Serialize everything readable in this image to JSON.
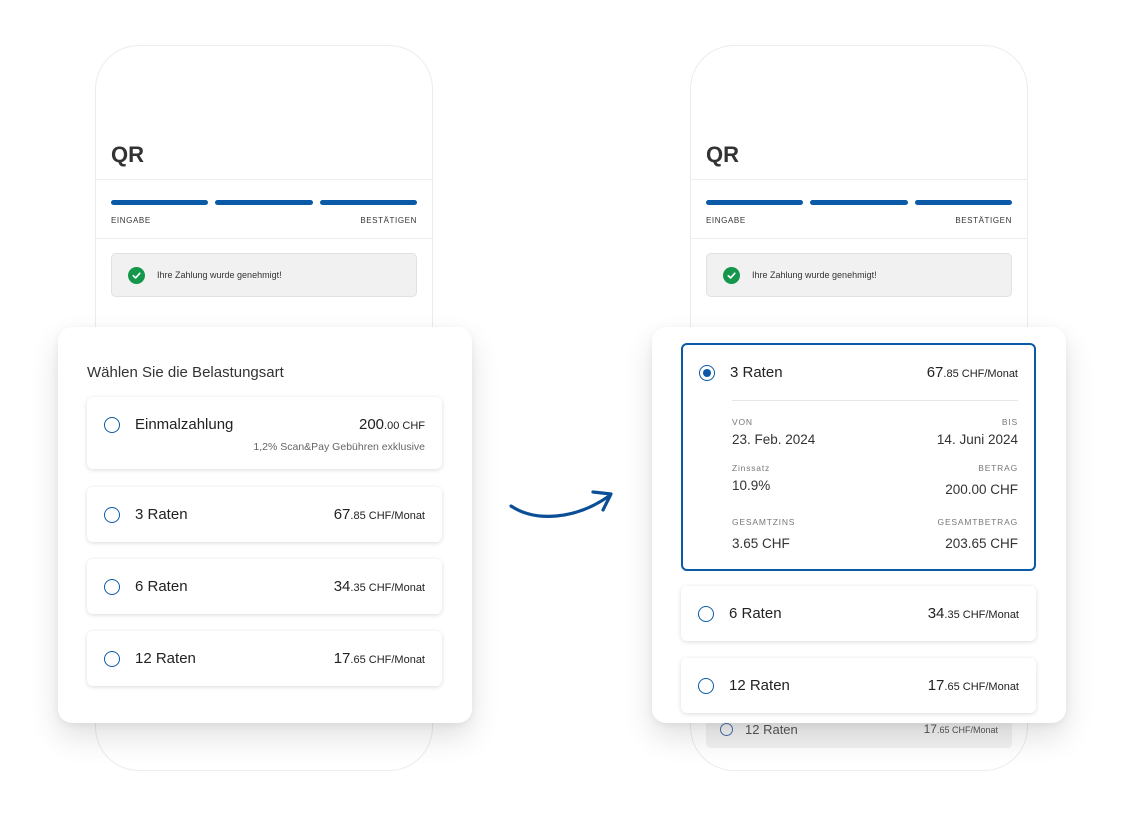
{
  "phone": {
    "title": "QR",
    "steps": {
      "start_label": "EINGABE",
      "end_label": "BESTÄTIGEN"
    },
    "alert_text": "Ihre Zahlung wurde genehmigt!",
    "peek_row": {
      "label": "12 Raten",
      "amount_main": "17",
      "amount_sub": ".65 CHF/Monat"
    }
  },
  "left_modal": {
    "heading": "Wählen Sie die Belastungsart",
    "options": [
      {
        "label": "Einmalzahlung",
        "amount_main": "200",
        "amount_sub": ".00 CHF",
        "note": "1,2% Scan&Pay Gebühren exklusive"
      },
      {
        "label": "3 Raten",
        "amount_main": "67",
        "amount_sub": ".85 CHF/Monat"
      },
      {
        "label": "6 Raten",
        "amount_main": "34",
        "amount_sub": ".35 CHF/Monat"
      },
      {
        "label": "12 Raten",
        "amount_main": "17",
        "amount_sub": ".65 CHF/Monat"
      }
    ]
  },
  "right_modal": {
    "selected": {
      "label": "3 Raten",
      "amount_main": "67",
      "amount_sub": ".85 CHF/Monat",
      "details": {
        "von_label": "VON",
        "von_value": "23. Feb. 2024",
        "bis_label": "BIS",
        "bis_value": "14. Juni 2024",
        "zinssatz_label": "Zinssatz",
        "zinssatz_value": "10.9%",
        "betrag_label": "BETRAG",
        "betrag_value": "200.00 CHF",
        "gesamtzins_label": "GESAMTZINS",
        "gesamtzins_value": "3.65 CHF",
        "gesamtbetrag_label": "GESAMTBETRAG",
        "gesamtbetrag_value": "203.65 CHF"
      }
    },
    "options": [
      {
        "label": "6 Raten",
        "amount_main": "34",
        "amount_sub": ".35 CHF/Monat"
      },
      {
        "label": "12 Raten",
        "amount_main": "17",
        "amount_sub": ".65 CHF/Monat"
      }
    ]
  },
  "colors": {
    "accent": "#0a5aa8",
    "success": "#15964d"
  },
  "icons": {
    "check": "check-icon",
    "arrow": "curved-arrow-icon"
  }
}
